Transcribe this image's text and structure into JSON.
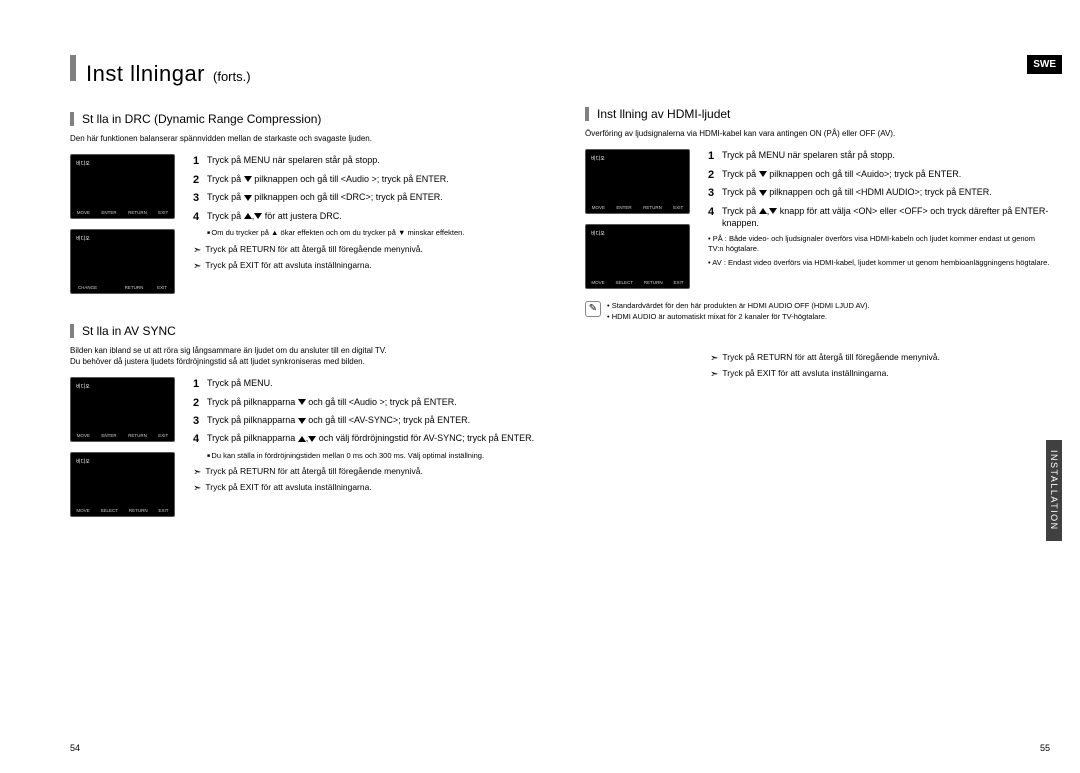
{
  "header": {
    "title": "Inst llningar",
    "subtitle": "(forts.)",
    "lang_badge": "SWE",
    "side_tab": "INSTALLATION"
  },
  "left": {
    "section1": {
      "title": "St lla in DRC (Dynamic Range Compression)",
      "intro": "Den här funktionen balanserar spännvidden mellan de starkaste och svagaste ljuden.",
      "steps": {
        "s1": "Tryck på MENU när spelaren står på stopp.",
        "s2a": "Tryck på ",
        "s2b": " pilknappen och gå till <Audio >; tryck på ENTER.",
        "s3a": "Tryck på ",
        "s3b": " pilknappen och gå till <DRC>; tryck på ENTER.",
        "s4a": "Tryck på ",
        "s4b": " för att justera DRC."
      },
      "note": "Om du trycker på ▲ ökar effekten och om du trycker på ▼ minskar effekten.",
      "ret": "Tryck på RETURN för att återgå till föregående menynivå.",
      "exit": "Tryck på EXIT för att avsluta inställningarna."
    },
    "section2": {
      "title": "St lla in AV SYNC",
      "intro": "Bilden kan ibland se ut att röra sig långsammare än ljudet om du ansluter till en digital TV.\nDu behöver då justera ljudets fördröjningstid så att ljudet synkroniseras med bilden.",
      "steps": {
        "s1": "Tryck på MENU.",
        "s2a": "Tryck på pilknapparna ",
        "s2b": " och gå till <Audio >; tryck på ENTER.",
        "s3a": "Tryck på pilknapparna ",
        "s3b": " och gå till <AV-SYNC>; tryck på ENTER.",
        "s4a": "Tryck på pilknapparna ",
        "s4b": " och välj fördröjningstid för AV-SYNC; tryck på ENTER."
      },
      "note": "Du kan ställa in fördröjningstiden mellan 0 ms och 300 ms. Välj optimal inställning.",
      "ret": "Tryck på RETURN för att återgå till föregående menynivå.",
      "exit": "Tryck på EXIT för att avsluta inställningarna."
    }
  },
  "right": {
    "section1": {
      "title": "Inst llning av HDMI-ljudet",
      "intro": "Överföring av ljudsignalerna via HDMI-kabel kan vara antingen ON (PÅ) eller OFF (AV).",
      "steps": {
        "s1": "Tryck på MENU när spelaren står på stopp.",
        "s2a": "Tryck på ",
        "s2b": " pilknappen och gå till <Auido>; tryck på ENTER.",
        "s3a": "Tryck på ",
        "s3b": " pilknappen och gå till <HDMI AUDIO>; tryck på ENTER.",
        "s4a": "Tryck på ",
        "s4b": " knapp för att välja <ON> eller <OFF> och tryck därefter på ENTER-knappen."
      },
      "bullets": {
        "on": "PÅ : Både video- och ljudsignaler överförs visa HDMI-kabeln och ljudet kommer endast ut genom TV:n högtalare.",
        "off": "AV : Endast video överförs via HDMI-kabel, ljudet kommer ut genom hembioanläggningens högtalare."
      },
      "info1": "Standardvärdet för den här produkten är HDMI AUDIO OFF (HDMI LJUD AV).",
      "info2": "HDMI AUDIO är automatiskt mixat för 2 kanaler för TV-högtalare.",
      "ret": "Tryck på RETURN för att återgå till föregående menynivå.",
      "exit": "Tryck på EXIT för att avsluta inställningarna."
    }
  },
  "screen": {
    "label": "비디오",
    "btns_a": [
      "MOVE",
      "ENTER",
      "RETURN",
      "EXIT"
    ],
    "btns_b": [
      "CHANGE",
      "",
      "RETURN",
      "EXIT"
    ],
    "btns_c": [
      "MOVE",
      "SELECT",
      "RETURN",
      "EXIT"
    ]
  },
  "pages": {
    "left": "54",
    "right": "55"
  }
}
